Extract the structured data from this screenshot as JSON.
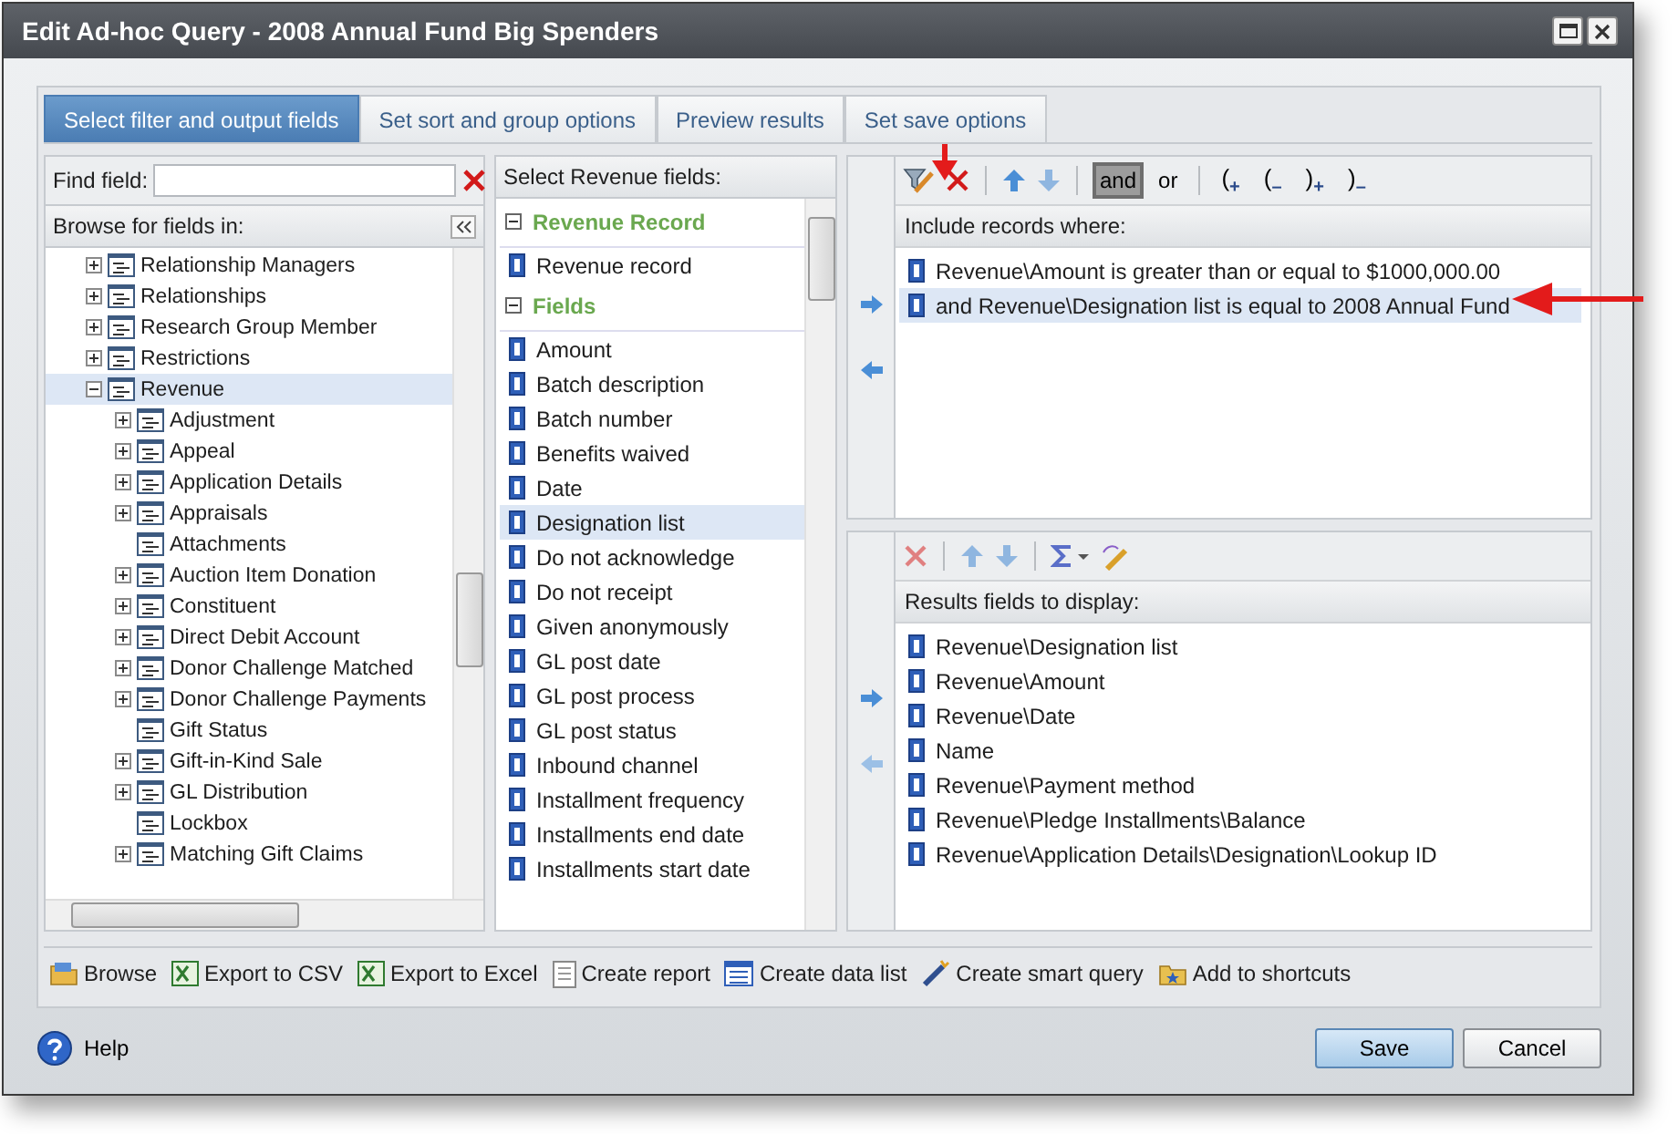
{
  "window": {
    "title": "Edit Ad-hoc Query - 2008 Annual Fund Big Spenders"
  },
  "tabs": [
    {
      "label": "Select filter and output fields",
      "selected": true
    },
    {
      "label": "Set sort and group options",
      "selected": false
    },
    {
      "label": "Preview results",
      "selected": false
    },
    {
      "label": "Set save options",
      "selected": false
    }
  ],
  "find_field": {
    "label": "Find field:"
  },
  "browse": {
    "header": "Browse for fields in:",
    "tree": [
      {
        "label": "Relationship Managers",
        "expanded": false,
        "selected": false
      },
      {
        "label": "Relationships",
        "expanded": false,
        "selected": false
      },
      {
        "label": "Research Group Member",
        "expanded": false,
        "selected": false
      },
      {
        "label": "Restrictions",
        "expanded": false,
        "selected": false
      },
      {
        "label": "Revenue",
        "expanded": true,
        "selected": true,
        "children": [
          {
            "label": "Adjustment",
            "expanded": false,
            "selected": false
          },
          {
            "label": "Appeal",
            "expanded": false,
            "selected": false
          },
          {
            "label": "Application Details",
            "expanded": false,
            "selected": false
          },
          {
            "label": "Appraisals",
            "expanded": false,
            "selected": false
          },
          {
            "label": "Attachments",
            "selected": false
          },
          {
            "label": "Auction Item Donation",
            "expanded": false,
            "selected": false
          },
          {
            "label": "Constituent",
            "expanded": false,
            "selected": false
          },
          {
            "label": "Direct Debit Account",
            "expanded": false,
            "selected": false
          },
          {
            "label": "Donor Challenge Matched",
            "expanded": false,
            "selected": false
          },
          {
            "label": "Donor Challenge Payments",
            "expanded": false,
            "selected": false
          },
          {
            "label": "Gift Status",
            "selected": false
          },
          {
            "label": "Gift-in-Kind Sale",
            "expanded": false,
            "selected": false
          },
          {
            "label": "GL Distribution",
            "expanded": false,
            "selected": false
          },
          {
            "label": "Lockbox",
            "selected": false
          },
          {
            "label": "Matching Gift Claims",
            "expanded": false,
            "selected": false
          }
        ]
      }
    ]
  },
  "fields": {
    "header": "Select Revenue fields:",
    "groups": [
      {
        "title": "Revenue Record",
        "expanded": true,
        "items": [
          {
            "label": "Revenue record",
            "selected": false
          }
        ]
      },
      {
        "title": "Fields",
        "expanded": true,
        "items": [
          {
            "label": "Amount",
            "selected": false
          },
          {
            "label": "Batch description",
            "selected": false
          },
          {
            "label": "Batch number",
            "selected": false
          },
          {
            "label": "Benefits waived",
            "selected": false
          },
          {
            "label": "Date",
            "selected": false
          },
          {
            "label": "Designation list",
            "selected": true
          },
          {
            "label": "Do not acknowledge",
            "selected": false
          },
          {
            "label": "Do not receipt",
            "selected": false
          },
          {
            "label": "Given anonymously",
            "selected": false
          },
          {
            "label": "GL post date",
            "selected": false
          },
          {
            "label": "GL post process",
            "selected": false
          },
          {
            "label": "GL post status",
            "selected": false
          },
          {
            "label": "Inbound channel",
            "selected": false
          },
          {
            "label": "Installment frequency",
            "selected": false
          },
          {
            "label": "Installments end date",
            "selected": false
          },
          {
            "label": "Installments start date",
            "selected": false
          }
        ]
      }
    ]
  },
  "filter": {
    "operators": [
      {
        "label": "and",
        "selected": true
      },
      {
        "label": "or",
        "selected": false
      }
    ],
    "parens": [
      {
        "paren": "(",
        "sign": "+"
      },
      {
        "paren": "(",
        "sign": "–"
      },
      {
        "paren": ")",
        "sign": "+"
      },
      {
        "paren": ")",
        "sign": "–"
      }
    ],
    "header": "Include records where:",
    "rows": [
      {
        "text": "Revenue\\Amount is greater than or equal to $1000,000.00",
        "selected": false
      },
      {
        "text": "and Revenue\\Designation list is equal to 2008 Annual Fund",
        "selected": true
      }
    ]
  },
  "results": {
    "header": "Results fields to display:",
    "rows": [
      "Revenue\\Designation list",
      "Revenue\\Amount",
      "Revenue\\Date",
      "Name",
      "Revenue\\Payment method",
      "Revenue\\Pledge Installments\\Balance",
      "Revenue\\Application Details\\Designation\\Lookup ID"
    ]
  },
  "actions": [
    {
      "label": "Browse",
      "kind": "folder"
    },
    {
      "label": "Export to CSV",
      "kind": "excel"
    },
    {
      "label": "Export to Excel",
      "kind": "excel"
    },
    {
      "label": "Create report",
      "kind": "report"
    },
    {
      "label": "Create data list",
      "kind": "list"
    },
    {
      "label": "Create smart query",
      "kind": "smart"
    },
    {
      "label": "Add to shortcuts",
      "kind": "shortcut"
    }
  ],
  "footer": {
    "help": "Help",
    "buttons": [
      {
        "label": "Save",
        "kind": "primary"
      },
      {
        "label": "Cancel",
        "kind": "secondary"
      }
    ]
  }
}
